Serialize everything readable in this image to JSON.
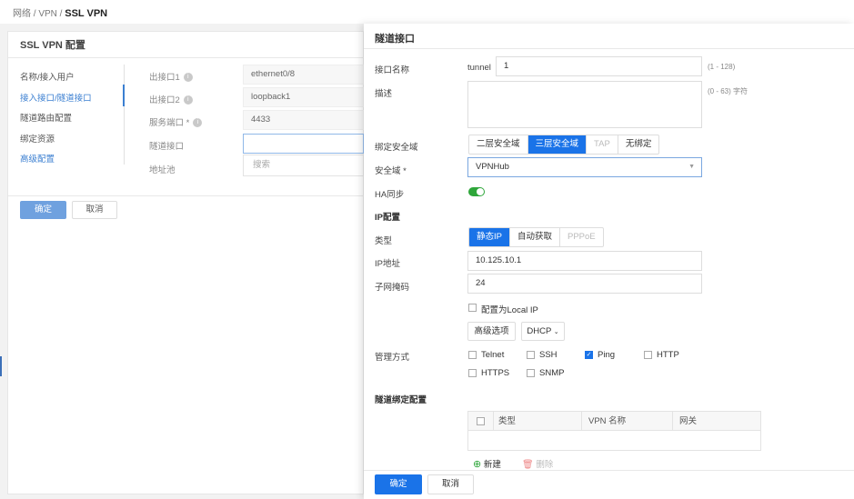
{
  "breadcrumb": {
    "part1": "网络 / VPN / ",
    "current": "SSL VPN"
  },
  "left": {
    "title": "SSL VPN 配置",
    "nav": [
      "名称/接入用户",
      "接入接口/隧道接口",
      "隧道路由配置",
      "绑定资源",
      "高级配置"
    ],
    "fields": {
      "out1_label": "出接口1",
      "out1_value": "ethernet0/8",
      "out2_label": "出接口2",
      "out2_value": "loopback1",
      "port_label": "服务端口 *",
      "port_value": "4433",
      "tunnel_label": "隧道接口",
      "tunnel_value": "",
      "pool_label": "地址池",
      "search_placeholder": "搜索"
    },
    "confirm": "确定",
    "cancel": "取消"
  },
  "right": {
    "title": "隧道接口",
    "ifname_label": "接口名称",
    "ifname_prefix": "tunnel",
    "ifname_value": "1",
    "ifname_hint": "(1 - 128)",
    "desc_label": "描述",
    "desc_value": "",
    "desc_hint": "(0 - 63) 字符",
    "zone_bind_label": "绑定安全域",
    "zone_bind_options": [
      "二层安全域",
      "三层安全域",
      "TAP",
      "无绑定"
    ],
    "zone_label": "安全域 *",
    "zone_value": "VPNHub",
    "ha_label": "HA同步",
    "ip_section": "IP配置",
    "type_label": "类型",
    "type_options": [
      "静态IP",
      "自动获取",
      "PPPoE"
    ],
    "ip_label": "IP地址",
    "ip_value": "10.125.10.1",
    "mask_label": "子网掩码",
    "mask_value": "24",
    "local_ip_label": "配置为Local IP",
    "adv_button": "高级选项",
    "dhcp_button": "DHCP",
    "mgmt_label": "管理方式",
    "mgmt_options": [
      "Telnet",
      "SSH",
      "Ping",
      "HTTP",
      "HTTPS",
      "SNMP"
    ],
    "tunnel_bind_section": "隧道绑定配置",
    "table_headers": [
      "类型",
      "VPN 名称",
      "网关"
    ],
    "new_label": "新建",
    "delete_label": "删除",
    "confirm": "确定",
    "cancel": "取消"
  }
}
